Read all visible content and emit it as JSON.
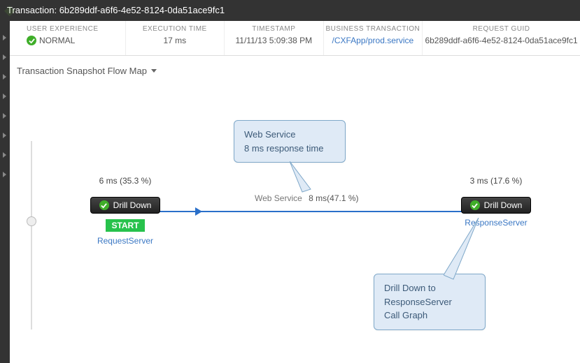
{
  "header": {
    "transaction_label": "Transaction:",
    "transaction_id": "6b289ddf-a6f6-4e52-8124-0da51ace9fc1"
  },
  "metrics": {
    "ux_label": "USER EXPERIENCE",
    "ux_value": "NORMAL",
    "exec_label": "EXECUTION TIME",
    "exec_value": "17 ms",
    "ts_label": "TIMESTAMP",
    "ts_value": "11/11/13 5:09:38 PM",
    "bt_label": "BUSINESS TRANSACTION",
    "bt_value": "/CXFApp/prod.service",
    "guid_label": "REQUEST GUID",
    "guid_value": "6b289ddf-a6f6-4e52-8124-0da51ace9fc1"
  },
  "snapshot_title": "Transaction Snapshot Flow Map",
  "nodes": {
    "request": {
      "timing": "6 ms (35.3 %)",
      "pill": "Drill Down",
      "badge": "START",
      "name": "RequestServer"
    },
    "response": {
      "timing": "3 ms (17.6 %)",
      "pill": "Drill Down",
      "name": "ResponseServer"
    }
  },
  "edge": {
    "service": "Web Service",
    "timing": "8 ms(47.1 %)"
  },
  "callouts": {
    "c1_line1": "Web Service",
    "c1_line2": "8 ms response time",
    "c2_line1": "Drill Down to",
    "c2_line2": "ResponseServer",
    "c2_line3": "Call Graph"
  }
}
